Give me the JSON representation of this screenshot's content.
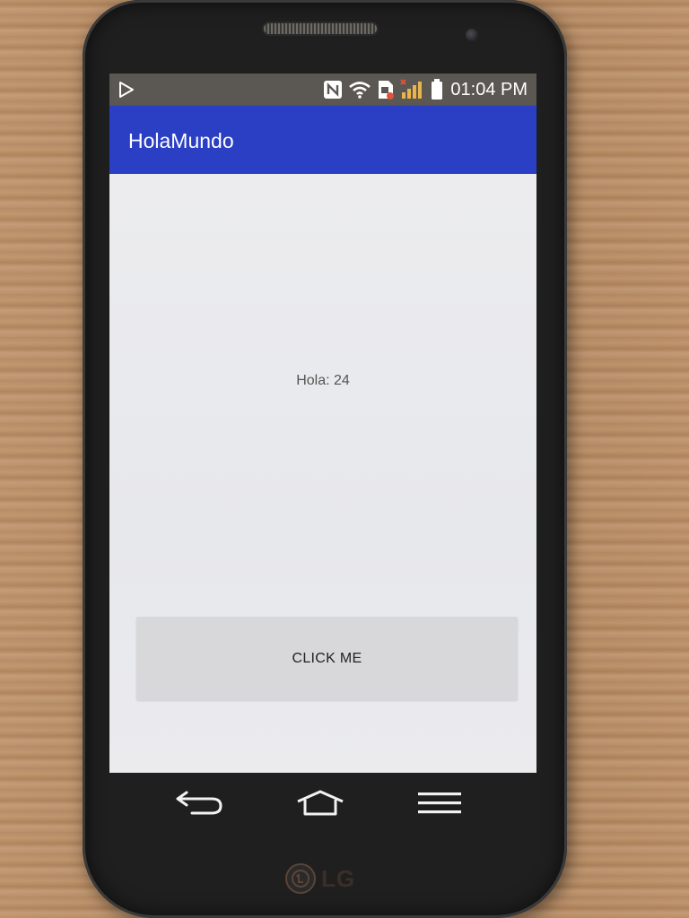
{
  "device": {
    "brand": "LG",
    "colors": {
      "body": "#1f1f1f",
      "wood": "#b88c64"
    }
  },
  "statusbar": {
    "time": "01:04 PM",
    "icons": [
      "play-store-icon",
      "nfc-icon",
      "wifi-icon",
      "sim-icon",
      "signal-icon",
      "battery-icon"
    ]
  },
  "appbar": {
    "title": "HolaMundo",
    "color": "#2a3fc4"
  },
  "content": {
    "label": "Hola: 24",
    "button_label": "CLICK ME"
  },
  "navbar": {
    "icons": [
      "back-icon",
      "home-icon",
      "menu-icon"
    ]
  }
}
